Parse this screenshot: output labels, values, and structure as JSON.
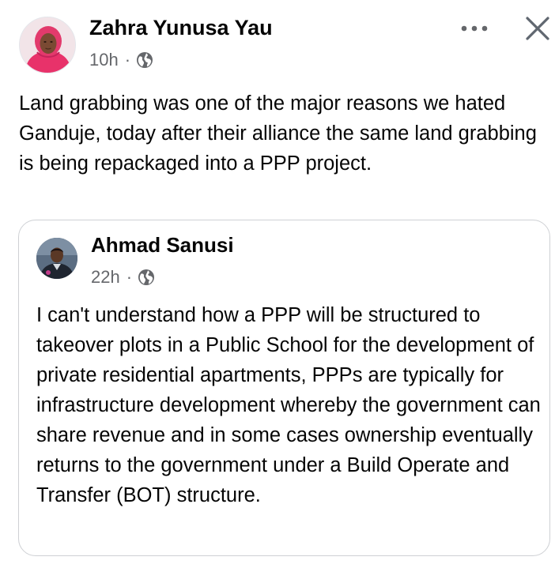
{
  "post": {
    "author": "Zahra Yunusa Yau",
    "time": "10h",
    "separator": "·",
    "audience_icon": "globe-icon",
    "text": "Land grabbing was one of the major reasons we hated Ganduje, today after their alliance the same land grabbing is being repackaged into a PPP project.",
    "actions": {
      "more_icon": "more-horizontal-icon",
      "close_icon": "close-icon"
    }
  },
  "shared_post": {
    "author": "Ahmad Sanusi",
    "time": "22h",
    "separator": "·",
    "audience_icon": "globe-icon",
    "text": "I can't understand how a PPP will be structured to takeover plots in a Public School for the development of private residential apartments, PPPs are typically for infrastructure development whereby the government can share revenue and in some cases ownership eventually returns to the government under a Build Operate and Transfer (BOT) structure."
  },
  "colors": {
    "text_primary": "#050505",
    "text_secondary": "#65676b",
    "card_border": "#ced0d4",
    "icon_gray": "#65676b",
    "avatar_hijab_pink": "#e8326a"
  }
}
